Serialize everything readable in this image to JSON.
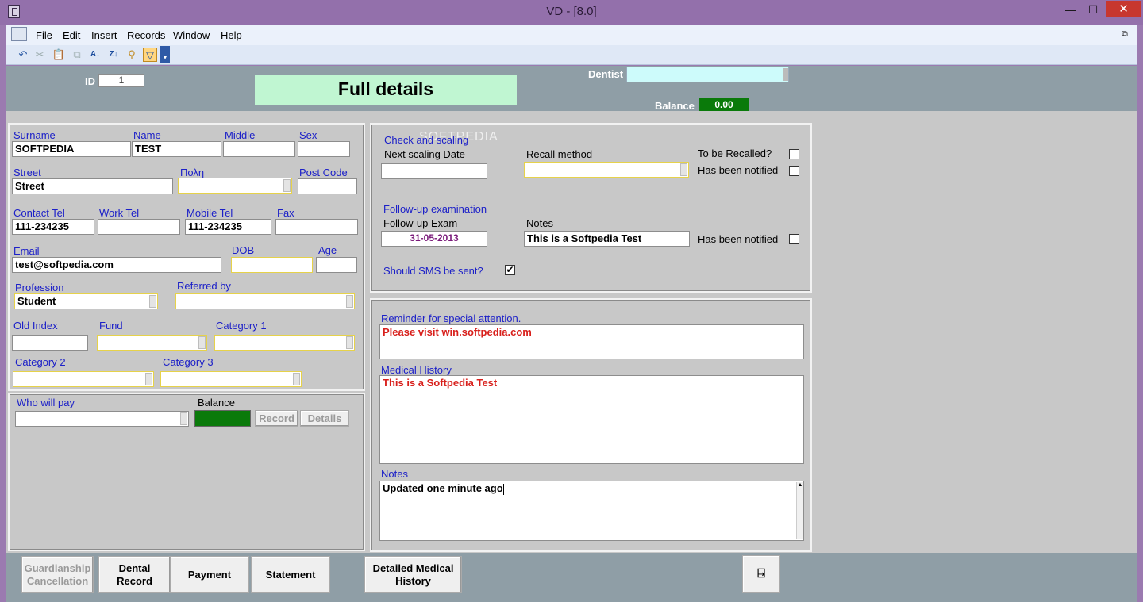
{
  "window": {
    "title": "VD - [8.0]",
    "minimize": "—",
    "maximize": "☐",
    "close": "✕",
    "restore": "⧉"
  },
  "menu": [
    "File",
    "Edit",
    "Insert",
    "Records",
    "Window",
    "Help"
  ],
  "toolbar": {
    "icons": [
      "undo-icon",
      "cut-icon",
      "paste-icon",
      "copy-icon",
      "sort-asc-icon",
      "sort-desc-icon",
      "filter-by-selection-icon",
      "filter-icon",
      "toolbar-options-icon"
    ]
  },
  "header": {
    "id_label": "ID",
    "id_value": "1",
    "title": "Full details",
    "dentist_label": "Dentist",
    "dentist_value": "",
    "balance_label": "Balance",
    "balance_value": "0.00",
    "balance_color": "#0a7a0a"
  },
  "personal": {
    "surname_label": "Surname",
    "surname": "SOFTPEDIA",
    "name_label": "Name",
    "name": "TEST",
    "middle_label": "Middle",
    "middle": "",
    "sex_label": "Sex",
    "sex": "",
    "street_label": "Street",
    "street": "Street",
    "city_label": "Πολη",
    "city": "",
    "postcode_label": "Post Code",
    "postcode": "",
    "contact_label": "Contact Tel",
    "contact": "111-234235",
    "work_label": "Work Tel",
    "work": "",
    "mobile_label": "Mobile Tel",
    "mobile": "111-234235",
    "fax_label": "Fax",
    "fax": "",
    "email_label": "Email",
    "email": "test@softpedia.com",
    "dob_label": "DOB",
    "dob": "",
    "age_label": "Age",
    "age": "",
    "profession_label": "Profession",
    "profession": "Student",
    "referred_label": "Referred by",
    "referred": "",
    "oldindex_label": "Old Index",
    "oldindex": "",
    "fund_label": "Fund",
    "fund": "",
    "cat1_label": "Category 1",
    "cat1": "",
    "cat2_label": "Category 2",
    "cat2": "",
    "cat3_label": "Category 3",
    "cat3": ""
  },
  "payer": {
    "who_label": "Who will pay",
    "who": "",
    "balance_label": "Balance",
    "balance_color": "#0a7a0a",
    "record_button": "Record",
    "details_button": "Details"
  },
  "scaling": {
    "section_label": "Check and scaling",
    "watermark": "SOFTPEDIA",
    "next_label": "Next scaling Date",
    "next": "",
    "recall_method_label": "Recall method",
    "recall_method": "",
    "to_be_recalled_label": "To be Recalled?",
    "to_be_recalled": "",
    "has_been_notified_label": "Has been notified",
    "notified1": "",
    "followup_section": "Follow-up examination",
    "followup_label": "Follow-up Exam",
    "followup": "31-05-2013",
    "notes_label": "Notes",
    "notes": "This is a Softpedia Test",
    "notified2": "",
    "sms_label": "Should SMS be sent?",
    "sms": "✔"
  },
  "medical": {
    "reminder_label": "Reminder for special attention.",
    "reminder": "Please visit win.softpedia.com",
    "history_label": "Medical History",
    "history": "This is a Softpedia Test",
    "notes_label": "Notes",
    "notes": "Updated one minute ago"
  },
  "footer": {
    "guardianship_l1": "Guardianship",
    "guardianship_l2": "Cancellation",
    "dental_l1": "Dental",
    "dental_l2": "Record",
    "payment": "Payment",
    "statement": "Statement",
    "detailed_l1": "Detailed Medical",
    "detailed_l2": "History",
    "exit_icon": "exit-door-icon"
  }
}
